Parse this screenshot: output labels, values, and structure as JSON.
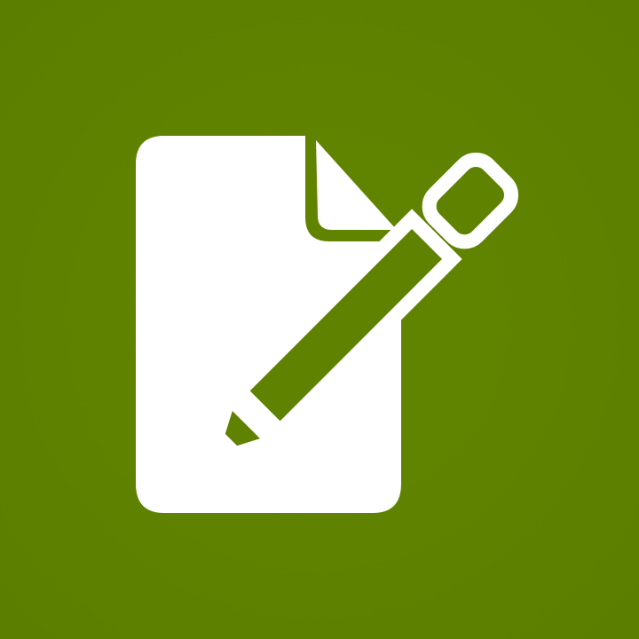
{
  "icon": {
    "name": "edit-document-icon",
    "background_color": "#5f8200",
    "foreground_color": "#ffffff",
    "parts": [
      "document-icon",
      "pencil-icon"
    ]
  }
}
